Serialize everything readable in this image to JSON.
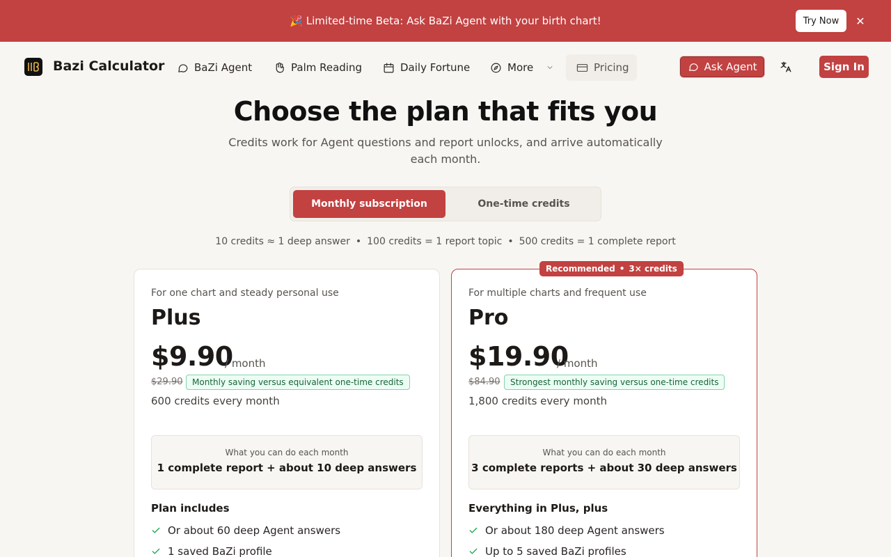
{
  "banner": {
    "emoji": "🎉",
    "text": "Limited-time Beta: Ask BaZi Agent with your birth chart!",
    "cta": "Try Now",
    "close": "✕"
  },
  "nav": {
    "brand": "Bazi Calculator",
    "items": [
      {
        "label": "BaZi Agent",
        "icon": "chat-bubble-icon"
      },
      {
        "label": "Palm Reading",
        "icon": "hand-icon"
      },
      {
        "label": "Daily Fortune",
        "icon": "calendar-icon"
      },
      {
        "label": "More",
        "icon": "compass-icon"
      },
      {
        "label": "Pricing",
        "icon": "credit-card-icon"
      }
    ],
    "ask_agent": "Ask Agent",
    "language_icon": "translate-icon",
    "sign_in": "Sign In"
  },
  "hero": {
    "title": "Choose the plan that fits you",
    "subtitle": "Credits work for Agent questions and report unlocks, and arrive automatically each month."
  },
  "toggle": {
    "monthly": "Monthly subscription",
    "onetime": "One-time credits",
    "selected": "monthly"
  },
  "credits_info": {
    "part1": "10 credits ≈ 1 deep answer",
    "part2": "100 credits = 1 report topic",
    "part3": "500 credits = 1 complete report",
    "separator": "•"
  },
  "plans": [
    {
      "tagline": "For one chart and steady personal use",
      "name": "Plus",
      "price": "$9.90",
      "per": "/ month",
      "old_price": "$29.90",
      "save": "Monthly saving versus equivalent one-time credits",
      "credits": "600 credits every month",
      "box_label": "What you can do each month",
      "box_value": "1 complete report + about 10 deep answers",
      "includes_title": "Plan includes",
      "features": [
        "Or about 60 deep Agent answers",
        "1 saved BaZi profile"
      ]
    },
    {
      "badge": "Recommended",
      "badge_extra": "3× credits",
      "badge_sep": "•",
      "tagline": "For multiple charts and frequent use",
      "name": "Pro",
      "price": "$19.90",
      "per": "/ month",
      "old_price": "$84.90",
      "save": "Strongest monthly saving versus one-time credits",
      "credits": "1,800 credits every month",
      "box_label": "What you can do each month",
      "box_value": "3 complete reports + about 30 deep answers",
      "includes_title": "Everything in Plus, plus",
      "features": [
        "Or about 180 deep Agent answers",
        "Up to 5 saved BaZi profiles"
      ]
    }
  ],
  "colors": {
    "accent": "#c24141",
    "background": "#f8f6f3",
    "success": "#16a34a"
  }
}
